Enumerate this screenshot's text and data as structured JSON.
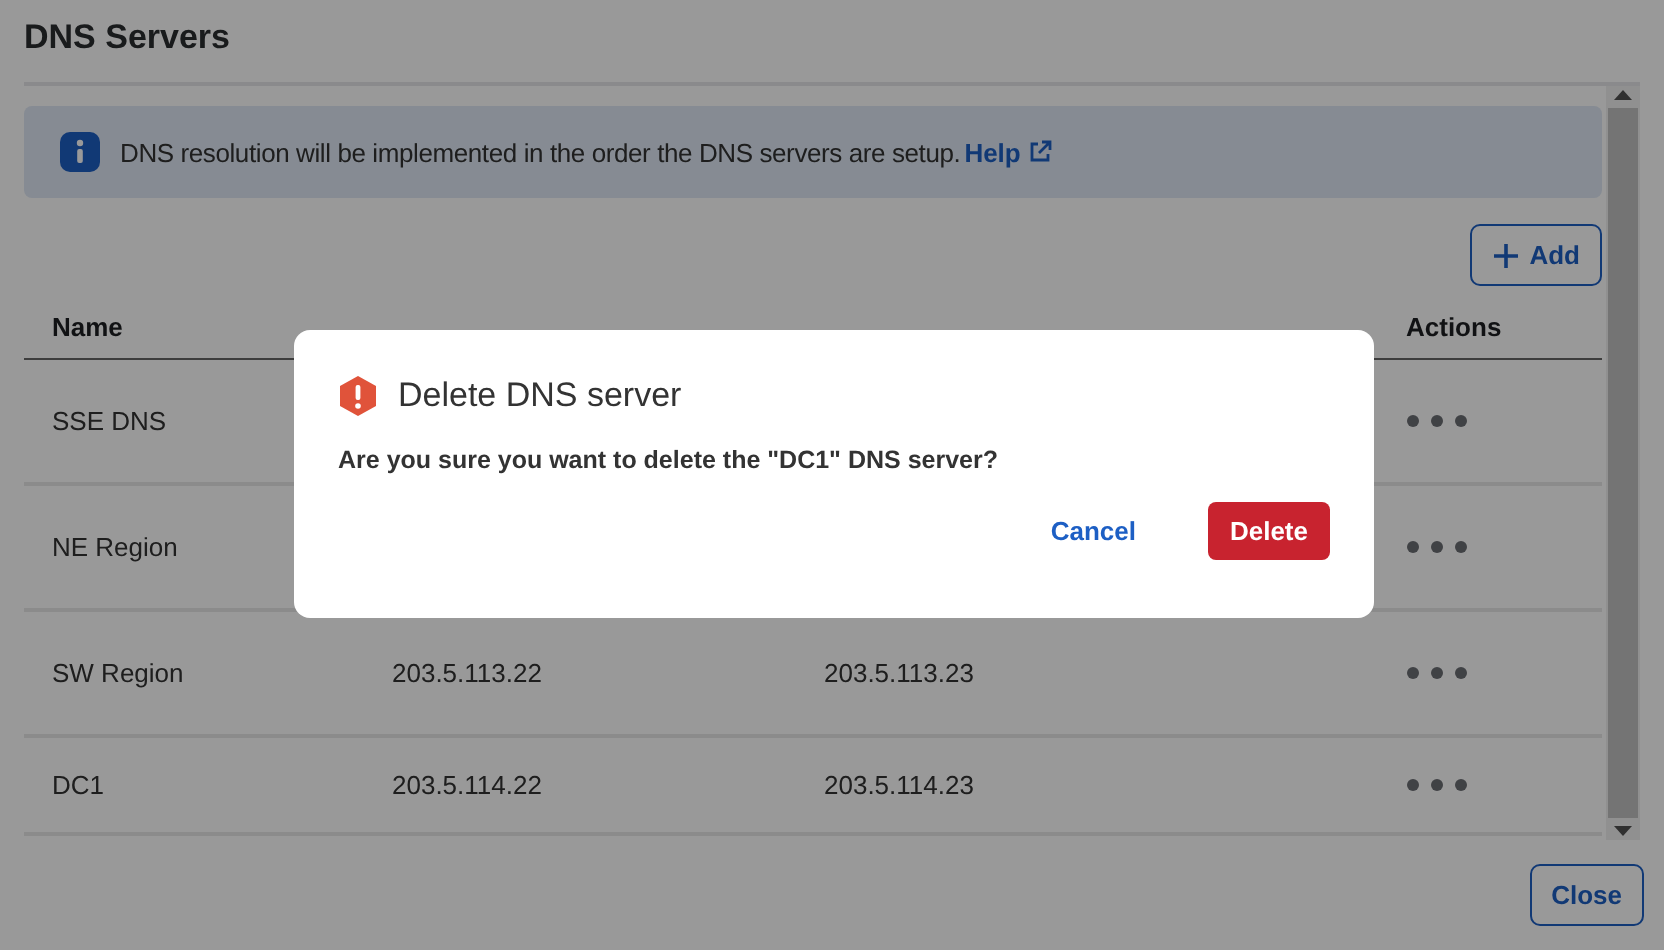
{
  "title": "DNS Servers",
  "info_banner": {
    "text": "DNS resolution will be implemented in the order the DNS servers are setup.",
    "link": "Help"
  },
  "add_button": "Add",
  "table": {
    "name_header": "Name",
    "actions_header": "Actions",
    "rows": [
      {
        "name": "SSE DNS"
      },
      {
        "name": "NE Region"
      },
      {
        "name": "SW Region",
        "dns_server_1": "203.5.113.22",
        "dns_server_2": "203.5.113.23"
      },
      {
        "name": "DC1",
        "dns_server_1": "203.5.114.22",
        "dns_server_2": "203.5.114.23"
      }
    ]
  },
  "close_button": "Close",
  "dialog": {
    "title": "Delete DNS server",
    "message": "Are you sure you want to delete the \"DC1\" DNS server?",
    "cancel": "Cancel",
    "confirm": "Delete"
  }
}
